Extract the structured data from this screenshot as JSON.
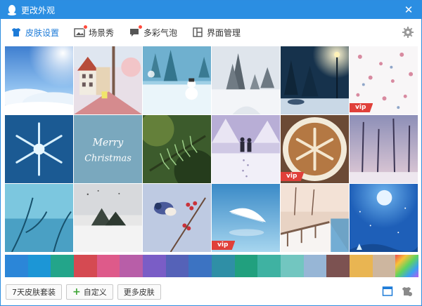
{
  "window": {
    "title": "更改外观",
    "close_icon": "close-icon"
  },
  "tabs": [
    {
      "label": "皮肤设置",
      "icon": "shirt-icon",
      "active": true,
      "badge": false
    },
    {
      "label": "场景秀",
      "icon": "picture-icon",
      "active": false,
      "badge": true
    },
    {
      "label": "多彩气泡",
      "icon": "chat-bubble-icon",
      "active": false,
      "badge": true
    },
    {
      "label": "界面管理",
      "icon": "layout-icon",
      "active": false,
      "badge": false
    }
  ],
  "skins": [
    {
      "name": "sky-clouds",
      "vip": false
    },
    {
      "name": "street-houses",
      "vip": false
    },
    {
      "name": "snowman-forest",
      "vip": false
    },
    {
      "name": "snowy-pines",
      "vip": false
    },
    {
      "name": "lamp-night-snow",
      "vip": false
    },
    {
      "name": "snowflake-pattern",
      "vip": true
    },
    {
      "name": "ice-snowflake",
      "vip": false
    },
    {
      "name": "merry-christmas",
      "vip": false
    },
    {
      "name": "pine-branch",
      "vip": false
    },
    {
      "name": "couple-snow-path",
      "vip": false
    },
    {
      "name": "coffee-snowflake",
      "vip": true
    },
    {
      "name": "winter-trees",
      "vip": false
    },
    {
      "name": "frozen-branches",
      "vip": false
    },
    {
      "name": "winter-lake",
      "vip": false
    },
    {
      "name": "bird-berries",
      "vip": false
    },
    {
      "name": "feather-blue",
      "vip": true
    },
    {
      "name": "snow-bridge",
      "vip": false
    },
    {
      "name": "moon-night",
      "vip": false
    }
  ],
  "vip_label": "vip",
  "colors": [
    "#2b86d8",
    "#1c96d6",
    "#23a58a",
    "#d54a52",
    "#de5a8a",
    "#b85ea8",
    "#7a5dc6",
    "#5562b8",
    "#3c73c2",
    "#2f8fa6",
    "#21a07e",
    "#3fb2a2",
    "#72c6c0",
    "#97b6d6",
    "#7c5251",
    "#e9b552",
    "#cdb69f",
    "rainbow"
  ],
  "bottom": {
    "trial_button": "7天皮肤套装",
    "custom_button": "自定义",
    "more_button": "更多皮肤",
    "window_icon": "window-icon",
    "wardrobe_icon": "wardrobe-icon"
  }
}
